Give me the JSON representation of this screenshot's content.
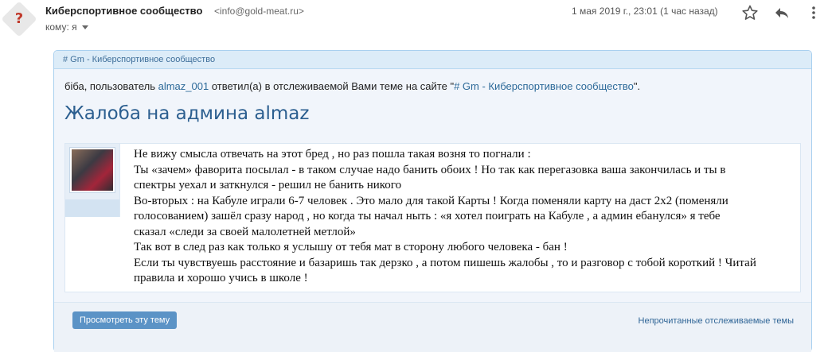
{
  "header": {
    "sender_name": "Киберспортивное сообщество",
    "sender_email": "<info@gold-meat.ru>",
    "recipient": "кому: я",
    "date": "1 мая 2019 г., 23:01 (1 час назад)",
    "avatar_char": "?"
  },
  "card": {
    "forum_tag": "# Gm - Киберспортивное сообщество",
    "intro": {
      "prefix": "біба, пользователь ",
      "user": "almaz_001",
      "middle": " ответил(а) в отслеживаемой Вами теме на сайте \"",
      "site": "# Gm - Киберспортивное сообщество",
      "suffix": "\"."
    },
    "title": "Жалоба на админа almaz",
    "post_lines": [
      "Не вижу смысла отвечать на этот бред , но раз пошла такая возня то погнали :",
      "Ты «зачем» фаворита посылал - в таком случае надо банить обоих ! Но так как перегазовка ваша закончилась и ты в",
      "спектры уехал и заткнулся - решил не банить никого",
      "Во-вторых : на Кабуле играли 6-7 человек . Это мало для такой Карты ! Когда поменяли карту на даст 2х2 (поменяли",
      "голосованием) зашёл сразу народ , но когда ты начал ныть : «я хотел поиграть на Кабуле , а админ ебанулся» я тебе",
      "сказал «следи за своей малолетней метлой»",
      "Так вот в след раз как только я услышу от тебя мат в сторону любого человека - бан !",
      "Если ты чувствуешь расстояние и базаришь так дерзко , а потом пишешь жалобы , то и разговор с тобой короткий ! Читай",
      "правила и хорошо учись в школе !"
    ],
    "view_button": "Просмотреть эту тему",
    "unread_link": "Непрочитанные отслеживаемые темы"
  },
  "colors": {
    "title": "#2c5f90",
    "button_bg": "#5b93c6",
    "card_border": "#a9d0ef"
  }
}
